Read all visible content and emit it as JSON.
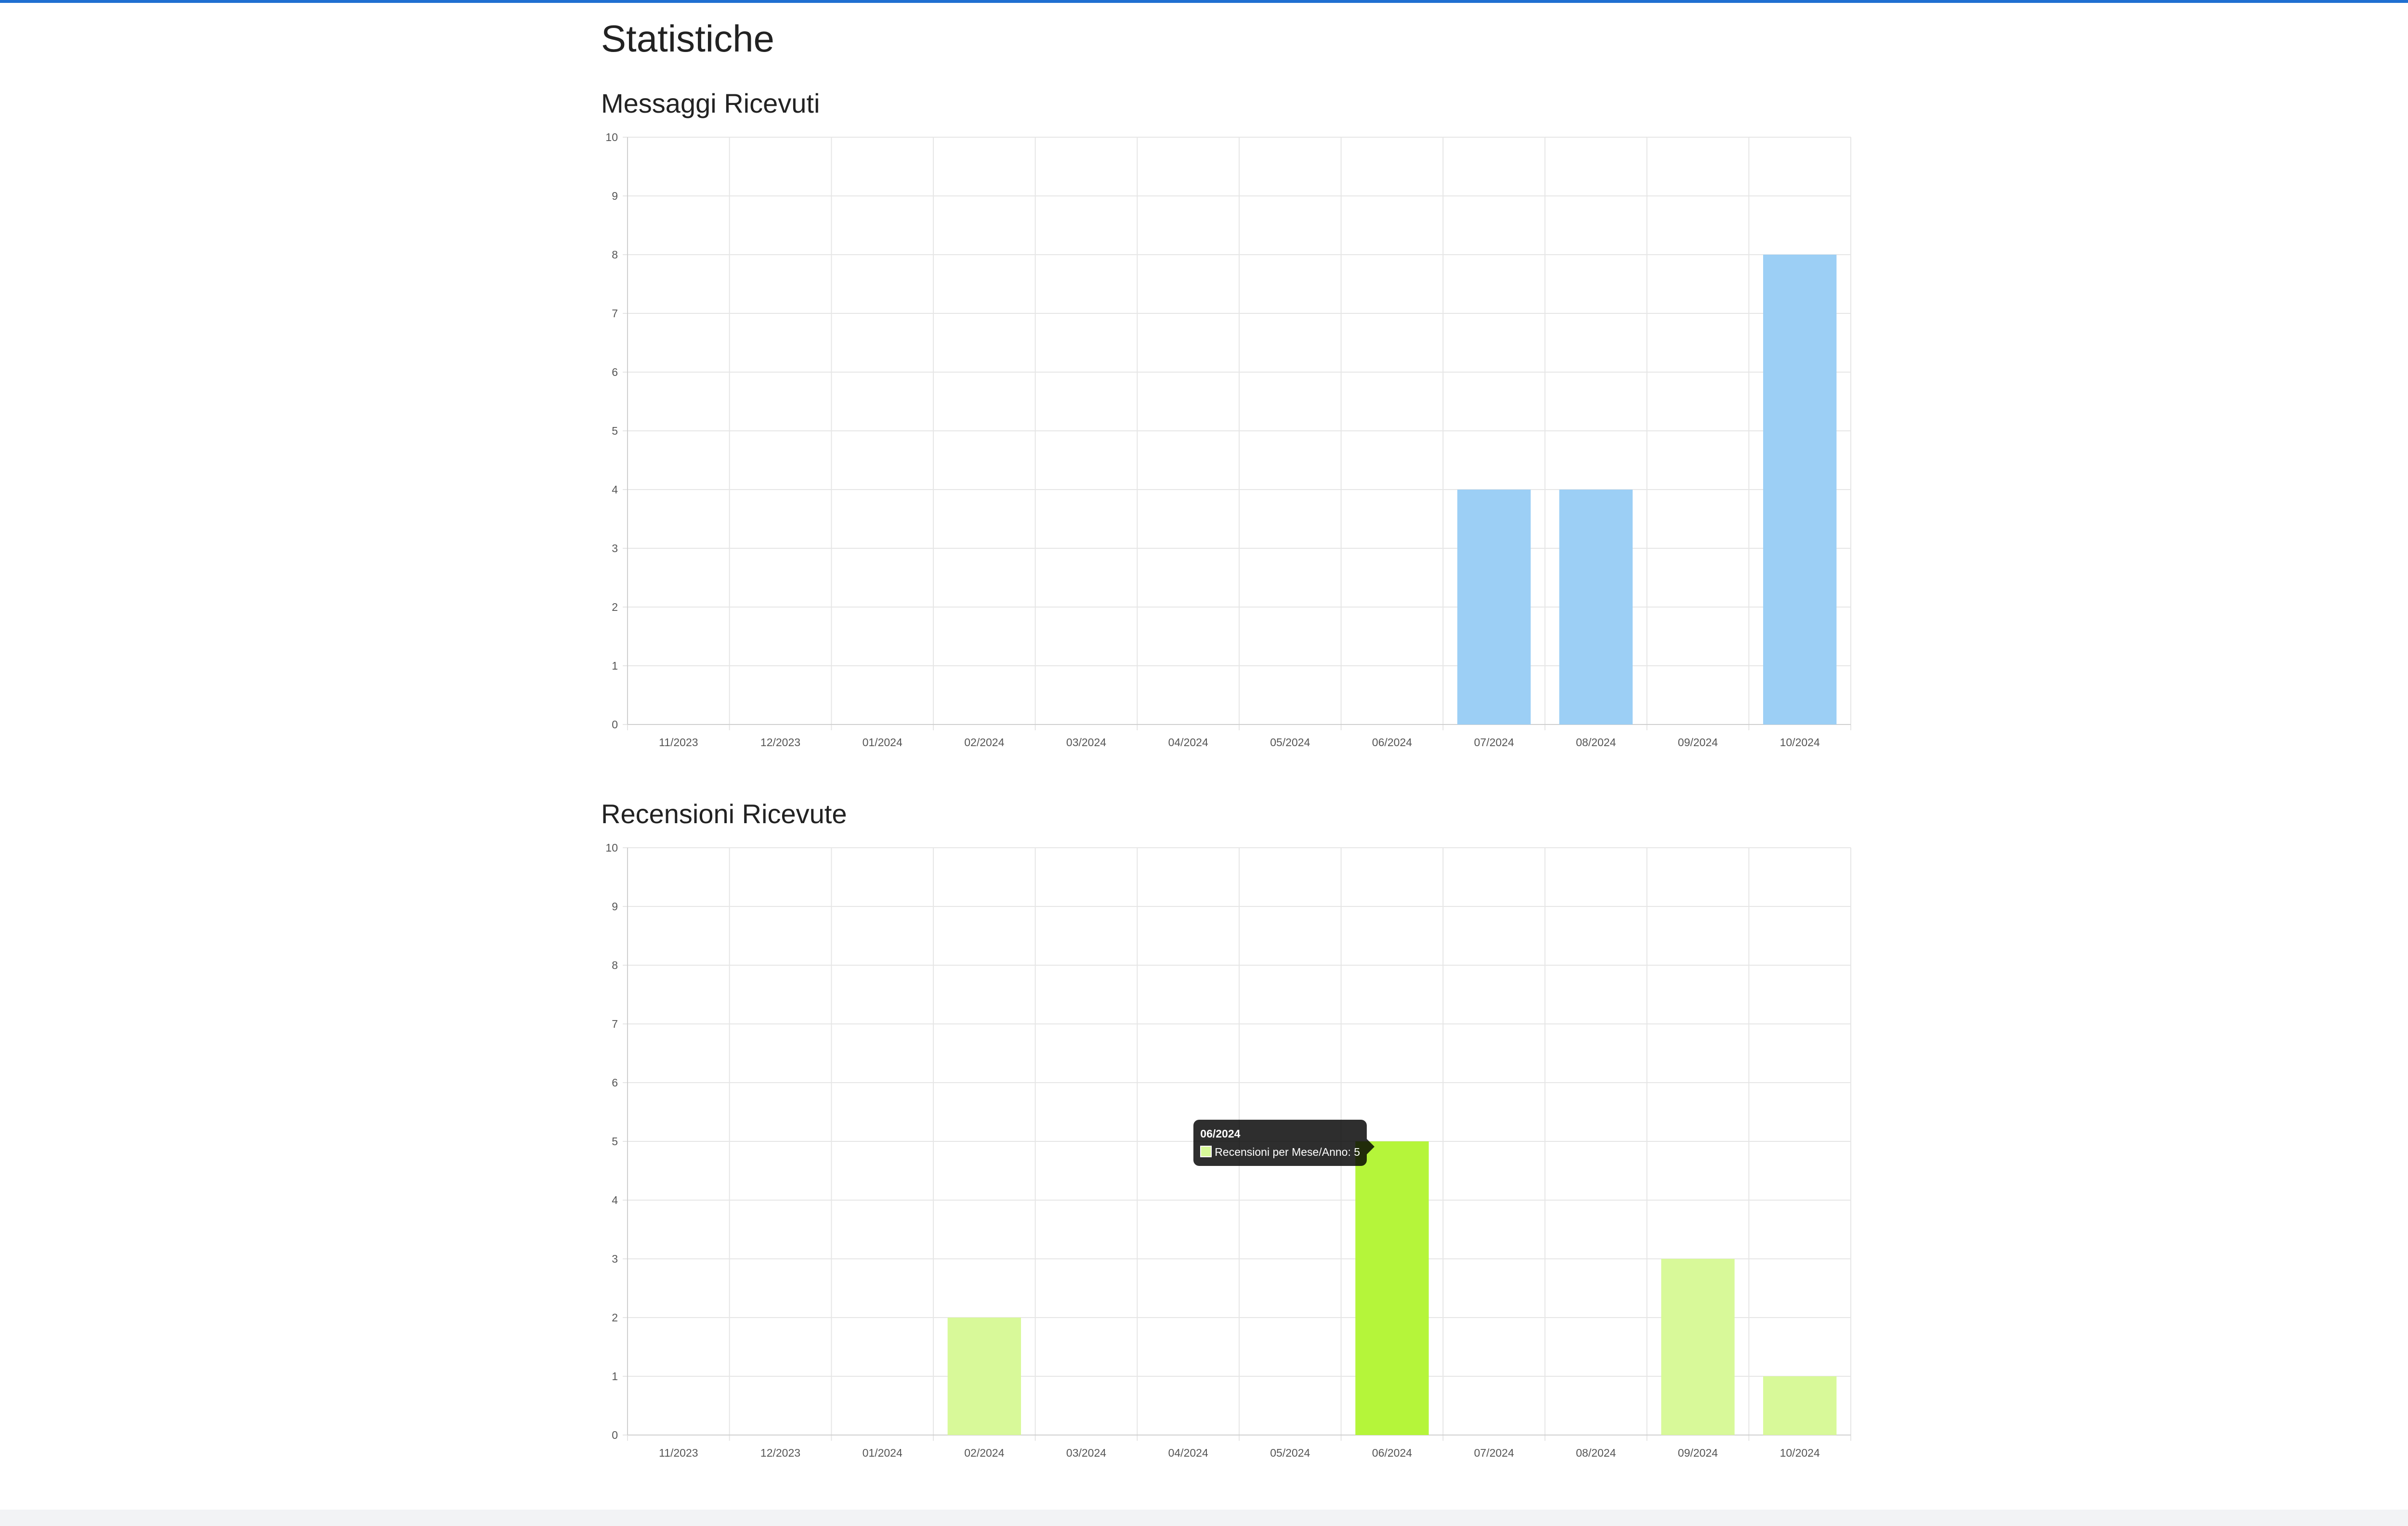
{
  "page": {
    "title": "Statistiche"
  },
  "colors": {
    "accent_top": "#1f6fd1",
    "messages_bar": "#9ccff5",
    "reviews_bar": "#d8f999",
    "reviews_bar_hover": "#b5f53a",
    "grid": "#e6e6e6"
  },
  "chart_data": [
    {
      "id": "messages",
      "type": "bar",
      "title": "Messaggi Ricevuti",
      "categories": [
        "11/2023",
        "12/2023",
        "01/2024",
        "02/2024",
        "03/2024",
        "04/2024",
        "05/2024",
        "06/2024",
        "07/2024",
        "08/2024",
        "09/2024",
        "10/2024"
      ],
      "values": [
        0,
        0,
        0,
        0,
        0,
        0,
        0,
        0,
        4,
        4,
        0,
        8
      ],
      "ylim": [
        0,
        10
      ],
      "yticks": [
        0,
        1,
        2,
        3,
        4,
        5,
        6,
        7,
        8,
        9,
        10
      ],
      "grid": true,
      "color": "#9ccff5"
    },
    {
      "id": "reviews",
      "type": "bar",
      "title": "Recensioni Ricevute",
      "categories": [
        "11/2023",
        "12/2023",
        "01/2024",
        "02/2024",
        "03/2024",
        "04/2024",
        "05/2024",
        "06/2024",
        "07/2024",
        "08/2024",
        "09/2024",
        "10/2024"
      ],
      "values": [
        0,
        0,
        0,
        2,
        0,
        0,
        0,
        5,
        0,
        0,
        3,
        1
      ],
      "ylim": [
        0,
        10
      ],
      "yticks": [
        0,
        1,
        2,
        3,
        4,
        5,
        6,
        7,
        8,
        9,
        10
      ],
      "grid": true,
      "color": "#d8f999",
      "highlight_color": "#b5f53a",
      "highlight_index": 7,
      "tooltip": {
        "title": "06/2024",
        "text": "Recensioni per Mese/Anno: 5"
      }
    }
  ]
}
